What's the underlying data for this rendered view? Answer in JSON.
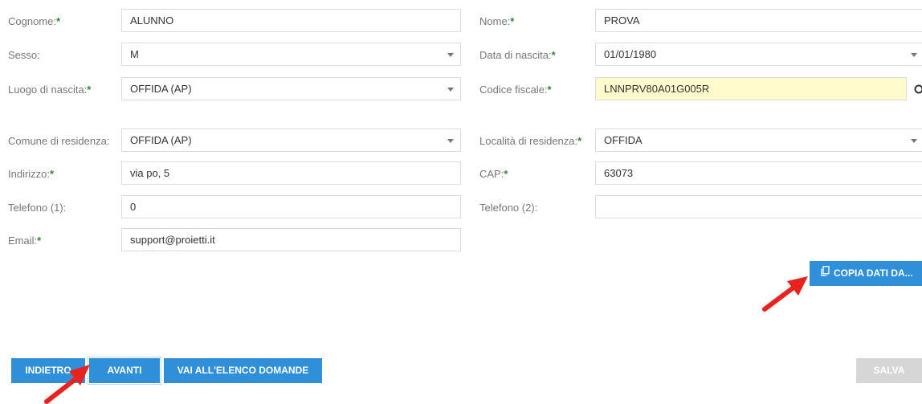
{
  "form": {
    "cognome": {
      "label": "Cognome:",
      "value": "ALUNNO"
    },
    "nome": {
      "label": "Nome:",
      "value": "PROVA"
    },
    "sesso": {
      "label": "Sesso:",
      "value": "M"
    },
    "data_nascita": {
      "label": "Data di nascita:",
      "value": "01/01/1980"
    },
    "luogo_nascita": {
      "label": "Luogo di nascita:",
      "value": "OFFIDA (AP)"
    },
    "codice_fiscale": {
      "label": "Codice fiscale:",
      "value": "LNNPRV80A01G005R"
    },
    "comune_residenza": {
      "label": "Comune di residenza:",
      "value": "OFFIDA (AP)"
    },
    "localita_residenza": {
      "label": "Località di residenza:",
      "value": "OFFIDA"
    },
    "indirizzo": {
      "label": "Indirizzo:",
      "value": "via po, 5"
    },
    "cap": {
      "label": "CAP:",
      "value": "63073"
    },
    "telefono1": {
      "label": "Telefono (1):",
      "value": "0"
    },
    "telefono2": {
      "label": "Telefono (2):",
      "value": ""
    },
    "email": {
      "label": "Email:",
      "value": "support@proietti.it"
    }
  },
  "required_marker": "*",
  "buttons": {
    "copia": "COPIA DATI DA...",
    "indietro": "INDIETRO",
    "avanti": "AVANTI",
    "elenco": "VAI ALL'ELENCO DOMANDE",
    "salva": "SALVA"
  },
  "colors": {
    "primary": "#2f8fd8",
    "required": "#2e8b2e",
    "highlight_field": "#fffbcc",
    "disabled": "#d6d6d6",
    "annotation_arrow": "#e8231f"
  }
}
